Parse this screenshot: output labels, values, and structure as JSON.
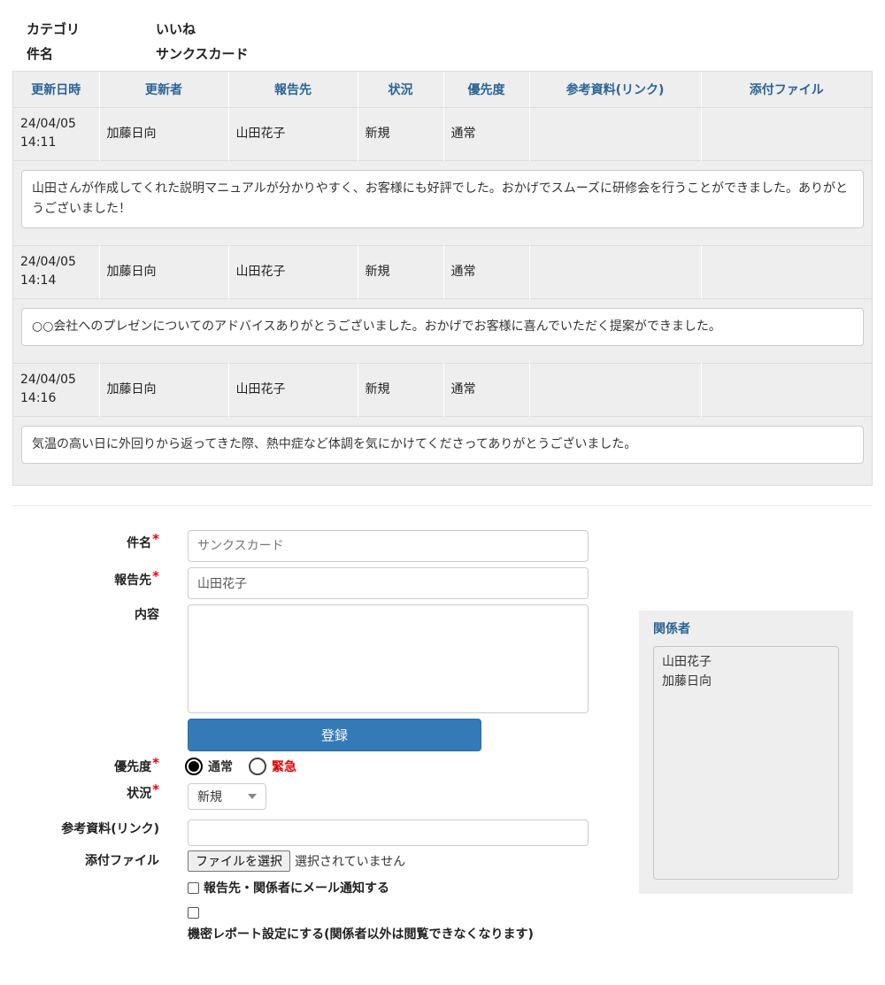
{
  "meta": {
    "category_label": "カテゴリ",
    "category_value": "いいね",
    "subject_label": "件名",
    "subject_value": "サンクスカード"
  },
  "history": {
    "columns": [
      "更新日時",
      "更新者",
      "報告先",
      "状況",
      "優先度",
      "参考資料(リンク)",
      "添付ファイル"
    ],
    "entries": [
      {
        "datetime_date": "24/04/05",
        "datetime_time": "14:11",
        "updater": "加藤日向",
        "report_to": "山田花子",
        "status": "新規",
        "priority": "通常",
        "link": "",
        "attachment": "",
        "message": "山田さんが作成してくれた説明マニュアルが分かりやすく、お客様にも好評でした。おかげでスムーズに研修会を行うことができました。ありがとうございました！"
      },
      {
        "datetime_date": "24/04/05",
        "datetime_time": "14:14",
        "updater": "加藤日向",
        "report_to": "山田花子",
        "status": "新規",
        "priority": "通常",
        "link": "",
        "attachment": "",
        "message": "○○会社へのプレゼンについてのアドバイスありがとうございました。おかげでお客様に喜んでいただく提案ができました。"
      },
      {
        "datetime_date": "24/04/05",
        "datetime_time": "14:16",
        "updater": "加藤日向",
        "report_to": "山田花子",
        "status": "新規",
        "priority": "通常",
        "link": "",
        "attachment": "",
        "message": "気温の高い日に外回りから返ってきた際、熱中症など体調を気にかけてくださってありがとうございました。"
      }
    ]
  },
  "form": {
    "subject_label": "件名",
    "subject_placeholder": "サンクスカード",
    "report_to_label": "報告先",
    "report_to_value": "山田花子",
    "content_label": "内容",
    "content_value": "",
    "register_button": "登録",
    "priority_label": "優先度",
    "priority_options": [
      "通常",
      "緊急"
    ],
    "priority_selected": "通常",
    "status_label": "状況",
    "status_value": "新規",
    "link_label": "参考資料(リンク)",
    "link_value": "",
    "attachment_label": "添付ファイル",
    "file_button": "ファイルを選択",
    "file_status": "選択されていません",
    "mail_notify_label": "報告先・関係者にメール通知する",
    "secret_label": "機密レポート設定にする(関係者以外は閲覧できなくなります)",
    "required_mark": "*"
  },
  "related": {
    "title": "関係者",
    "people": [
      "山田花子",
      "加藤日向"
    ]
  },
  "colors": {
    "accent": "#337ab7",
    "header_text": "#2a6496",
    "required": "#e00000",
    "panel_bg": "#eeeeee"
  }
}
